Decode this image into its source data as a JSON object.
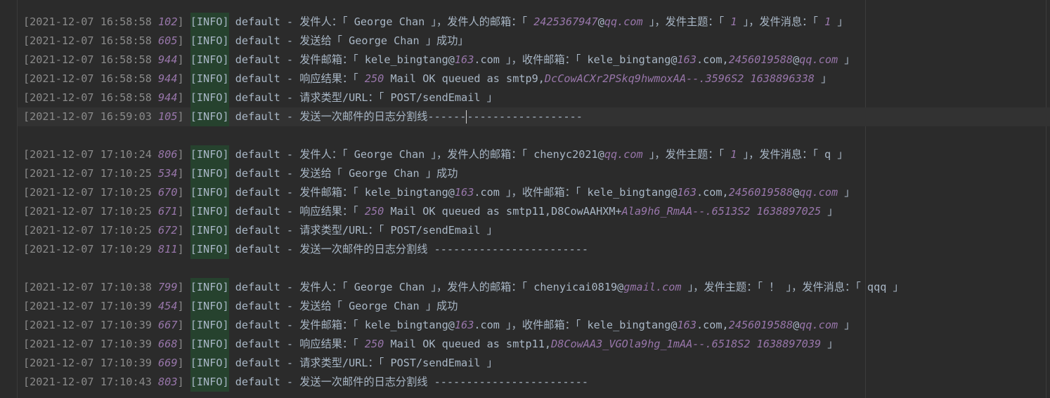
{
  "lines": [
    {
      "ts": "2021-12-07 16:58:58",
      "ms": "102",
      "level": "[INFO]",
      "msg": [
        {
          "t": " default - 发件人：「 George Chan 」，发件人的邮箱：「 ",
          "k": "txt"
        },
        {
          "t": "2425367947",
          "k": "num"
        },
        {
          "t": "@",
          "k": "txt"
        },
        {
          "t": "qq.com",
          "k": "num"
        },
        {
          "t": " 」，发件主题：「 ",
          "k": "txt"
        },
        {
          "t": "1",
          "k": "num"
        },
        {
          "t": " 」，发件消息：「 ",
          "k": "txt"
        },
        {
          "t": "1",
          "k": "num"
        },
        {
          "t": " 」",
          "k": "txt"
        }
      ]
    },
    {
      "ts": "2021-12-07 16:58:58",
      "ms": "605",
      "level": "[INFO]",
      "msg": [
        {
          "t": " default - 发送给「 George Chan 」成功」",
          "k": "txt"
        }
      ]
    },
    {
      "ts": "2021-12-07 16:58:58",
      "ms": "944",
      "level": "[INFO]",
      "msg": [
        {
          "t": " default - 发件邮箱：「 kele_bingtang@",
          "k": "txt"
        },
        {
          "t": "163",
          "k": "num"
        },
        {
          "t": ".com 」，收件邮箱：「 kele_bingtang@",
          "k": "txt"
        },
        {
          "t": "163",
          "k": "num"
        },
        {
          "t": ".com,",
          "k": "txt"
        },
        {
          "t": "2456019588",
          "k": "num"
        },
        {
          "t": "@",
          "k": "txt"
        },
        {
          "t": "qq.com",
          "k": "num"
        },
        {
          "t": " 」",
          "k": "txt"
        }
      ]
    },
    {
      "ts": "2021-12-07 16:58:58",
      "ms": "944",
      "level": "[INFO]",
      "msg": [
        {
          "t": " default - 响应结果：「 ",
          "k": "txt"
        },
        {
          "t": "250",
          "k": "num"
        },
        {
          "t": " Mail OK queued as smtp9,",
          "k": "txt"
        },
        {
          "t": "DcCowACXr2PSkq9hwmoxAA--.3596S2 1638896338",
          "k": "num"
        },
        {
          "t": " 」",
          "k": "txt"
        }
      ]
    },
    {
      "ts": "2021-12-07 16:58:58",
      "ms": "944",
      "level": "[INFO]",
      "msg": [
        {
          "t": " default - 请求类型/URL：「 POST/sendEmail 」",
          "k": "txt"
        }
      ]
    },
    {
      "ts": "2021-12-07 16:59:03",
      "ms": "105",
      "level": "[INFO]",
      "caret": true,
      "msg": [
        {
          "t": " default - 发送一次邮件的日志分割线------",
          "k": "txt"
        },
        {
          "t": "",
          "k": "caret"
        },
        {
          "t": "------------------",
          "k": "txt"
        }
      ]
    },
    {
      "blank": true
    },
    {
      "ts": "2021-12-07 17:10:24",
      "ms": "806",
      "level": "[INFO]",
      "msg": [
        {
          "t": " default - 发件人：「 George Chan 」，发件人的邮箱：「 chenyc2021@",
          "k": "txt"
        },
        {
          "t": "qq.com",
          "k": "num"
        },
        {
          "t": " 」，发件主题：「 ",
          "k": "txt"
        },
        {
          "t": "1",
          "k": "num"
        },
        {
          "t": " 」，发件消息：「 q 」",
          "k": "txt"
        }
      ]
    },
    {
      "ts": "2021-12-07 17:10:25",
      "ms": "534",
      "level": "[INFO]",
      "msg": [
        {
          "t": " default - 发送给「 George Chan 」成功",
          "k": "txt"
        }
      ]
    },
    {
      "ts": "2021-12-07 17:10:25",
      "ms": "670",
      "level": "[INFO]",
      "msg": [
        {
          "t": " default - 发件邮箱：「 kele_bingtang@",
          "k": "txt"
        },
        {
          "t": "163",
          "k": "num"
        },
        {
          "t": ".com 」，收件邮箱：「 kele_bingtang@",
          "k": "txt"
        },
        {
          "t": "163",
          "k": "num"
        },
        {
          "t": ".com,",
          "k": "txt"
        },
        {
          "t": "2456019588",
          "k": "num"
        },
        {
          "t": "@",
          "k": "txt"
        },
        {
          "t": "qq.com",
          "k": "num"
        },
        {
          "t": " 」",
          "k": "txt"
        }
      ]
    },
    {
      "ts": "2021-12-07 17:10:25",
      "ms": "671",
      "level": "[INFO]",
      "msg": [
        {
          "t": " default - 响应结果：「 ",
          "k": "txt"
        },
        {
          "t": "250",
          "k": "num"
        },
        {
          "t": " Mail OK queued as smtp11,D8CowAAHXM+",
          "k": "txt"
        },
        {
          "t": "Ala9h6_RmAA--.6513S2 1638897025",
          "k": "num"
        },
        {
          "t": " 」",
          "k": "txt"
        }
      ]
    },
    {
      "ts": "2021-12-07 17:10:25",
      "ms": "672",
      "level": "[INFO]",
      "msg": [
        {
          "t": " default - 请求类型/URL：「 POST/sendEmail 」",
          "k": "txt"
        }
      ]
    },
    {
      "ts": "2021-12-07 17:10:29",
      "ms": "811",
      "level": "[INFO]",
      "msg": [
        {
          "t": " default - 发送一次邮件的日志分割线 ------------------------",
          "k": "txt"
        }
      ]
    },
    {
      "blank": true
    },
    {
      "ts": "2021-12-07 17:10:38",
      "ms": "799",
      "level": "[INFO]",
      "msg": [
        {
          "t": " default - 发件人：「 George Chan 」，发件人的邮箱：「 chenyicai0819@",
          "k": "txt"
        },
        {
          "t": "gmail.com",
          "k": "num"
        },
        {
          "t": " 」，发件主题：「 ！ 」，发件消息：「 qqq 」",
          "k": "txt"
        }
      ]
    },
    {
      "ts": "2021-12-07 17:10:39",
      "ms": "454",
      "level": "[INFO]",
      "msg": [
        {
          "t": " default - 发送给「 George Chan 」成功",
          "k": "txt"
        }
      ]
    },
    {
      "ts": "2021-12-07 17:10:39",
      "ms": "667",
      "level": "[INFO]",
      "msg": [
        {
          "t": " default - 发件邮箱：「 kele_bingtang@",
          "k": "txt"
        },
        {
          "t": "163",
          "k": "num"
        },
        {
          "t": ".com 」，收件邮箱：「 kele_bingtang@",
          "k": "txt"
        },
        {
          "t": "163",
          "k": "num"
        },
        {
          "t": ".com,",
          "k": "txt"
        },
        {
          "t": "2456019588",
          "k": "num"
        },
        {
          "t": "@",
          "k": "txt"
        },
        {
          "t": "qq.com",
          "k": "num"
        },
        {
          "t": " 」",
          "k": "txt"
        }
      ]
    },
    {
      "ts": "2021-12-07 17:10:39",
      "ms": "668",
      "level": "[INFO]",
      "msg": [
        {
          "t": " default - 响应结果：「 ",
          "k": "txt"
        },
        {
          "t": "250",
          "k": "num"
        },
        {
          "t": " Mail OK queued as smtp11,",
          "k": "txt"
        },
        {
          "t": "D8CowAA3_VGOla9hg_1mAA--.6518S2 1638897039",
          "k": "num"
        },
        {
          "t": " 」",
          "k": "txt"
        }
      ]
    },
    {
      "ts": "2021-12-07 17:10:39",
      "ms": "669",
      "level": "[INFO]",
      "msg": [
        {
          "t": " default - 请求类型/URL：「 POST/sendEmail 」",
          "k": "txt"
        }
      ]
    },
    {
      "ts": "2021-12-07 17:10:43",
      "ms": "803",
      "level": "[INFO]",
      "msg": [
        {
          "t": " default - 发送一次邮件的日志分割线 ------------------------",
          "k": "txt"
        }
      ]
    }
  ]
}
